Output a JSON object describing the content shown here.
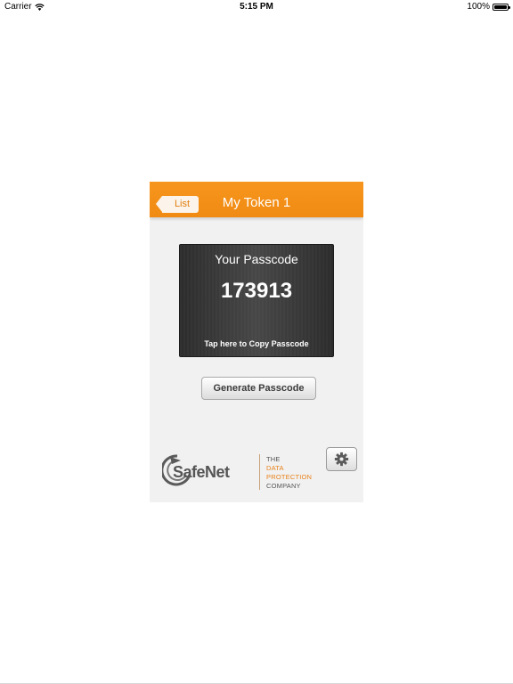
{
  "status_bar": {
    "carrier": "Carrier",
    "time": "5:15 PM",
    "battery": "100%",
    "battery_level": 1.0
  },
  "nav": {
    "back_label": "List",
    "title": "My Token 1"
  },
  "passcode_card": {
    "heading": "Your Passcode",
    "code": "173913",
    "hint": "Tap here to Copy Passcode"
  },
  "actions": {
    "generate_label": "Generate Passcode"
  },
  "branding": {
    "logo_text": "SafeNet",
    "tagline": [
      "THE",
      "DATA",
      "PROTECTION",
      "COMPANY"
    ],
    "accent_color": "#f7961e",
    "logo_icon": "safenet-swirl-icon"
  },
  "settings_icon": "gear-icon"
}
